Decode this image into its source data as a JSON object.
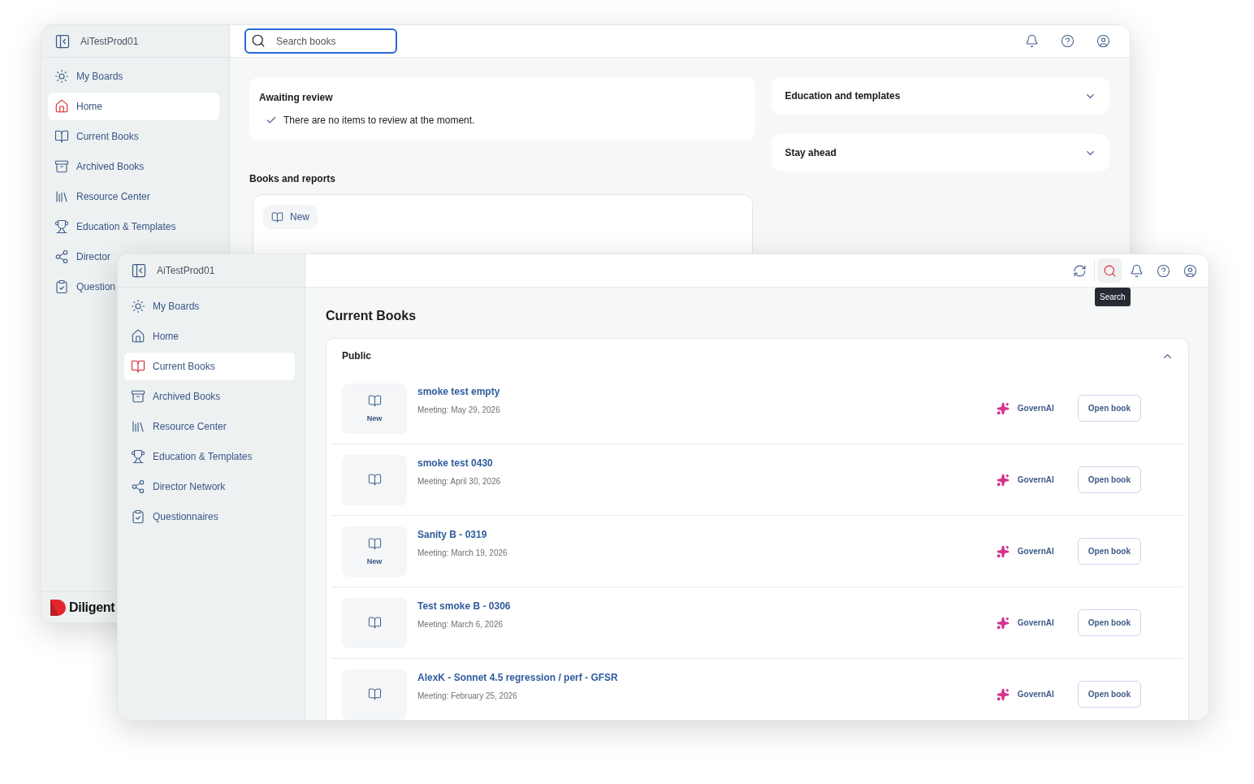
{
  "back_window": {
    "workspace": "AiTestProd01",
    "nav": [
      {
        "label": "My Boards",
        "selected": false
      },
      {
        "label": "Home",
        "selected": true
      },
      {
        "label": "Current Books",
        "selected": false
      },
      {
        "label": "Archived Books",
        "selected": false
      },
      {
        "label": "Resource Center",
        "selected": false
      },
      {
        "label": "Education & Templates",
        "selected": false
      },
      {
        "label": "Director",
        "selected": false
      },
      {
        "label": "Question",
        "selected": false
      }
    ],
    "search": {
      "placeholder": "Search books"
    },
    "awaiting_review": {
      "title": "Awaiting review",
      "message": "There are no items to review at the moment."
    },
    "books_heading": "Books and reports",
    "books_card": {
      "badge": "New"
    },
    "panels": [
      {
        "title": "Education and templates",
        "expanded": false
      },
      {
        "title": "Stay ahead",
        "expanded": false
      }
    ],
    "logo": "Diligent"
  },
  "front_window": {
    "workspace": "AiTestProd01",
    "nav": [
      {
        "label": "My Boards",
        "selected": false
      },
      {
        "label": "Home",
        "selected": false
      },
      {
        "label": "Current Books",
        "selected": true
      },
      {
        "label": "Archived Books",
        "selected": false
      },
      {
        "label": "Resource Center",
        "selected": false
      },
      {
        "label": "Education & Templates",
        "selected": false
      },
      {
        "label": "Director Network",
        "selected": false
      },
      {
        "label": "Questionnaires",
        "selected": false
      }
    ],
    "toolbar": [
      {
        "selected": false
      },
      {
        "selected": true
      },
      {
        "selected": false
      },
      {
        "selected": false
      },
      {
        "selected": false
      }
    ],
    "tooltip": "Search",
    "title": "Current Books",
    "section": {
      "title": "Public",
      "expanded": true
    },
    "books": [
      {
        "title": "smoke test empty",
        "meeting": "Meeting: May 29, 2026",
        "badge": "New",
        "assistant": "GovernAI",
        "action": "Open book"
      },
      {
        "title": "smoke test 0430",
        "meeting": "Meeting: April 30, 2026",
        "assistant": "GovernAI",
        "action": "Open book"
      },
      {
        "title": "Sanity B - 0319",
        "meeting": "Meeting: March 19, 2026",
        "badge": "New",
        "assistant": "GovernAI",
        "action": "Open book"
      },
      {
        "title": "Test smoke B - 0306",
        "meeting": "Meeting: March 6, 2026",
        "assistant": "GovernAI",
        "action": "Open book"
      },
      {
        "title": "AlexK - Sonnet 4.5 regression / perf - GFSR",
        "meeting": "Meeting: February 25, 2026",
        "assistant": "GovernAI",
        "action": "Open book"
      }
    ]
  }
}
